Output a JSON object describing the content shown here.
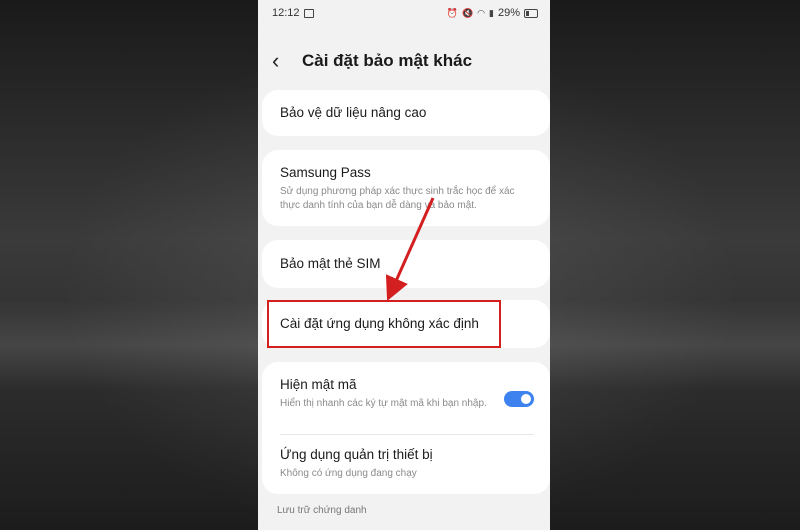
{
  "status_bar": {
    "time": "12:12",
    "battery": "29%"
  },
  "header": {
    "back_icon": "chevron-left-icon",
    "title": "Cài đặt bảo mật khác"
  },
  "items": [
    {
      "title": "Bảo vệ dữ liệu nâng cao"
    },
    {
      "title": "Samsung Pass",
      "subtitle": "Sử dụng phương pháp xác thực sinh trắc học để xác thực danh tính của bạn dễ dàng và bảo mật."
    },
    {
      "title": "Bảo mật thẻ SIM"
    },
    {
      "title": "Cài đặt ứng dụng không xác định"
    },
    {
      "title": "Hiện mật mã",
      "subtitle": "Hiển thị nhanh các ký tự mật mã khi bạn nhập.",
      "toggle_on": true
    },
    {
      "title": "Ứng dụng quản trị thiết bị",
      "subtitle": "Không có ứng dụng đang chạy"
    }
  ],
  "section_label": "Lưu trữ chứng danh",
  "colors": {
    "highlight": "#d31f1f",
    "toggle_accent": "#3e82f0",
    "background": "#f2f2f2",
    "card": "#ffffff"
  }
}
